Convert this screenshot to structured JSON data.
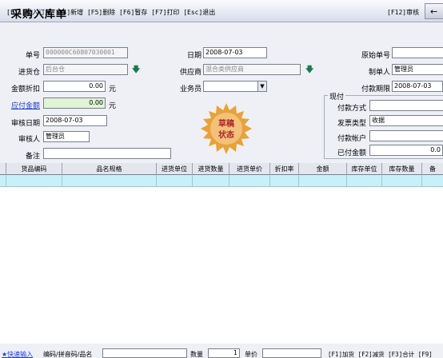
{
  "window": {
    "title": "采购入库单"
  },
  "toolbar": {
    "left": "[F11]导入订单 [F4]新增 [F5]删除 [F6]暂存 [F7]打印 [Esc]退出",
    "right": "[F12]审核"
  },
  "form": {
    "doc_no_label": "单号",
    "doc_no": "000000C60807030001",
    "date_label": "日期",
    "date": "2008-07-03",
    "orig_no_label": "原始单号",
    "orig_no": "",
    "warehouse_label": "进货仓",
    "warehouse": "后台仓",
    "supplier_label": "供应商",
    "supplier": "混合类供应商",
    "creator_label": "制单人",
    "creator": "管理员",
    "discount_label": "金额折扣",
    "discount": "0.00",
    "discount_unit": "元",
    "salesman_label": "业务员",
    "salesman": "",
    "due_label": "付款期限",
    "due": "2008-07-03",
    "payable_label": "应付金额",
    "payable": "0.00",
    "payable_unit": "元",
    "audit_date_label": "审核日期",
    "audit_date": "2008-07-03",
    "auditor_label": "审核人",
    "auditor": "管理员",
    "remark_label": "备注",
    "remark": ""
  },
  "payment": {
    "group_title": "现付",
    "method_label": "付款方式",
    "method": "",
    "invoice_label": "发票类型",
    "invoice": "收据",
    "account_label": "付款帐户",
    "account": "",
    "paid_label": "已付金额",
    "paid": "0.0"
  },
  "stamp": {
    "line1": "草稿",
    "line2": "状态"
  },
  "grid": {
    "columns": [
      "货品编码",
      "品名规格",
      "进货单位",
      "进货数量",
      "进货单价",
      "折扣率",
      "金额",
      "库存单位",
      "库存数量",
      "备"
    ]
  },
  "bottom": {
    "quick_input": "★快速输入",
    "code_label": "编码/拼音码/品名",
    "qty_label": "数量",
    "qty": "1",
    "price_label": "单价",
    "shortcuts": "[F1]加货 [F2]减货 [F3]合计 [F9]"
  },
  "colors": {
    "accent": "#1a3ec8",
    "grid_row": "#c7f0f8",
    "stamp": "#e8a23a"
  }
}
